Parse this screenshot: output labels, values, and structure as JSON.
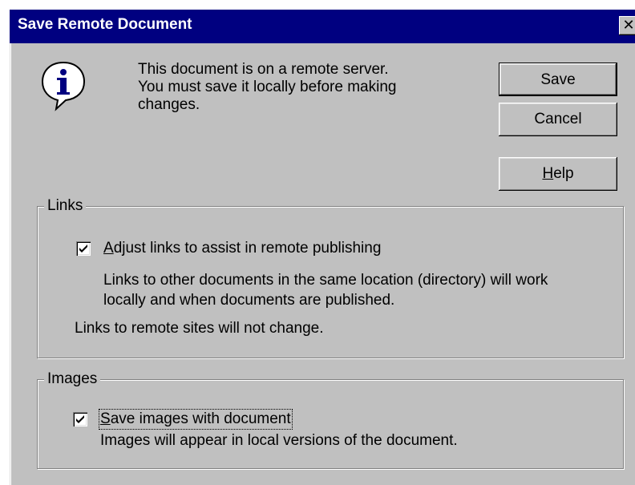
{
  "window": {
    "title": "Save Remote Document",
    "close_glyph": "✕"
  },
  "message": {
    "icon": "info-icon",
    "lines": [
      "This document is on a remote server.",
      "You must save it locally before making",
      "changes."
    ]
  },
  "buttons": {
    "save": "Save",
    "cancel": "Cancel",
    "help_mnemonic": "H",
    "help_rest": "elp"
  },
  "links_group": {
    "label": "Links",
    "checkbox": {
      "checked": true,
      "mnemonic": "A",
      "label_rest": "djust links to assist in remote publishing"
    },
    "desc_lines": [
      "Links to other documents in the same location (directory) will work",
      "locally and when documents are published."
    ],
    "note": "Links to remote sites will not change."
  },
  "images_group": {
    "label": "Images",
    "checkbox": {
      "checked": true,
      "mnemonic": "S",
      "label_rest": "ave images with document"
    },
    "desc": "Images will appear in local versions of the document."
  },
  "colors": {
    "title_bar": "#000080",
    "dialog_face": "#c0c0c0"
  }
}
